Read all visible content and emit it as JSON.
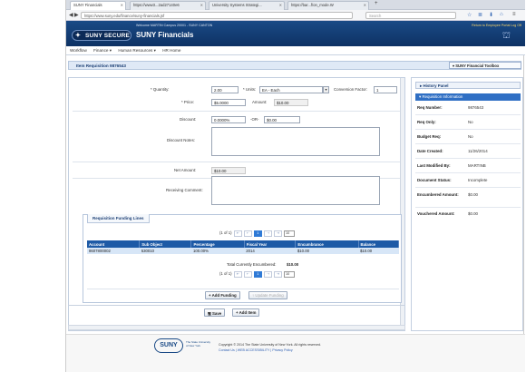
{
  "browser": {
    "tabs": [
      {
        "label": "SUNY Financials"
      },
      {
        "label": "https://www3...2ad27140e6"
      },
      {
        "label": "University Systems Strategi..."
      },
      {
        "label": "https://bar...f/on_mode.W"
      }
    ],
    "url": "https://www.suny.edu/finance/suny-financials.jsf",
    "search_placeholder": "Search"
  },
  "header": {
    "logo_text": "SUNY SECURE",
    "app_title": "SUNY Financials",
    "welcome": "Welcome  MARTIN   Campus  20001 - SUNY CANTON",
    "links": "Return to Employee Portal   Log Off"
  },
  "menu": {
    "items": [
      "Workflow",
      "Finance ▾",
      "Human Resources ▾",
      "HR Home"
    ]
  },
  "page": {
    "title": "Item Requisition 9876543",
    "toolbox_label": "SUNY Financial Toolbox"
  },
  "form": {
    "quantity_label": "* Quantity:",
    "quantity_value": "2.00",
    "units_label": "* Units:",
    "units_value": "EA - Each",
    "conversion_label": "Conversion Factor:",
    "conversion_value": "1",
    "price_label": "* Price:",
    "price_value": "$5.0000",
    "amount_label": "Amount:",
    "amount_value": "$10.00",
    "discount_label": "Discount:",
    "discount_pct": "0.0000%",
    "or_label": "-OR-",
    "discount_amt": "$0.00",
    "discount_notes_label": "Discount Notes:",
    "net_amount_label": "Net Amount:",
    "net_amount_value": "$10.00",
    "receiving_label": "Receiving Comment:"
  },
  "funding": {
    "title": "Requisition Funding Lines",
    "pager_text": "(1 of 1)",
    "page_current": "1",
    "page_size": "10",
    "columns": [
      "Account",
      "Sub Object",
      "Percentage",
      "Fiscal Year",
      "Encumbrance",
      "Balance"
    ],
    "rows": [
      {
        "account": "8607800002",
        "sub_object": "530010",
        "percentage": "100.00%",
        "fiscal_year": "2014",
        "encumbrance": "$10.00",
        "balance": "$10.00"
      }
    ],
    "total_label": "Total Currently Encumbered:",
    "total_value": "$10.00",
    "add_funding": "+ Add Funding",
    "update_funding": "↑ Update Funding"
  },
  "actions": {
    "save": "Save",
    "add_item": "+ Add Item"
  },
  "right_panel": {
    "history_panel": "History Panel",
    "info_title": "Requisition Information",
    "fields": [
      {
        "label": "Req Number:",
        "value": "9876543"
      },
      {
        "label": "Req Only:",
        "value": "No"
      },
      {
        "label": "Budget Req:",
        "value": "No"
      },
      {
        "label": "Date Created:",
        "value": "11/26/2014"
      },
      {
        "label": "Last Modified By:",
        "value": "MARTINB"
      },
      {
        "label": "Document Status:",
        "value": "Incomplete"
      },
      {
        "label": "Encumbered Amount:",
        "value": "$0.00"
      },
      {
        "label": "Vouchered Amount:",
        "value": "$0.00"
      }
    ]
  },
  "footer": {
    "logo": "SUNY",
    "logo_sub": "The State University of New York",
    "copyright": "Copyright © 2014 The State University of New York. All rights reserved.",
    "links": "Contact Us  |  WEB ACCESSIBILITY  |  Privacy Policy"
  },
  "colors": {
    "header": "#0e3264",
    "accent": "#1d5aa6",
    "arrow": "#f5c518"
  }
}
